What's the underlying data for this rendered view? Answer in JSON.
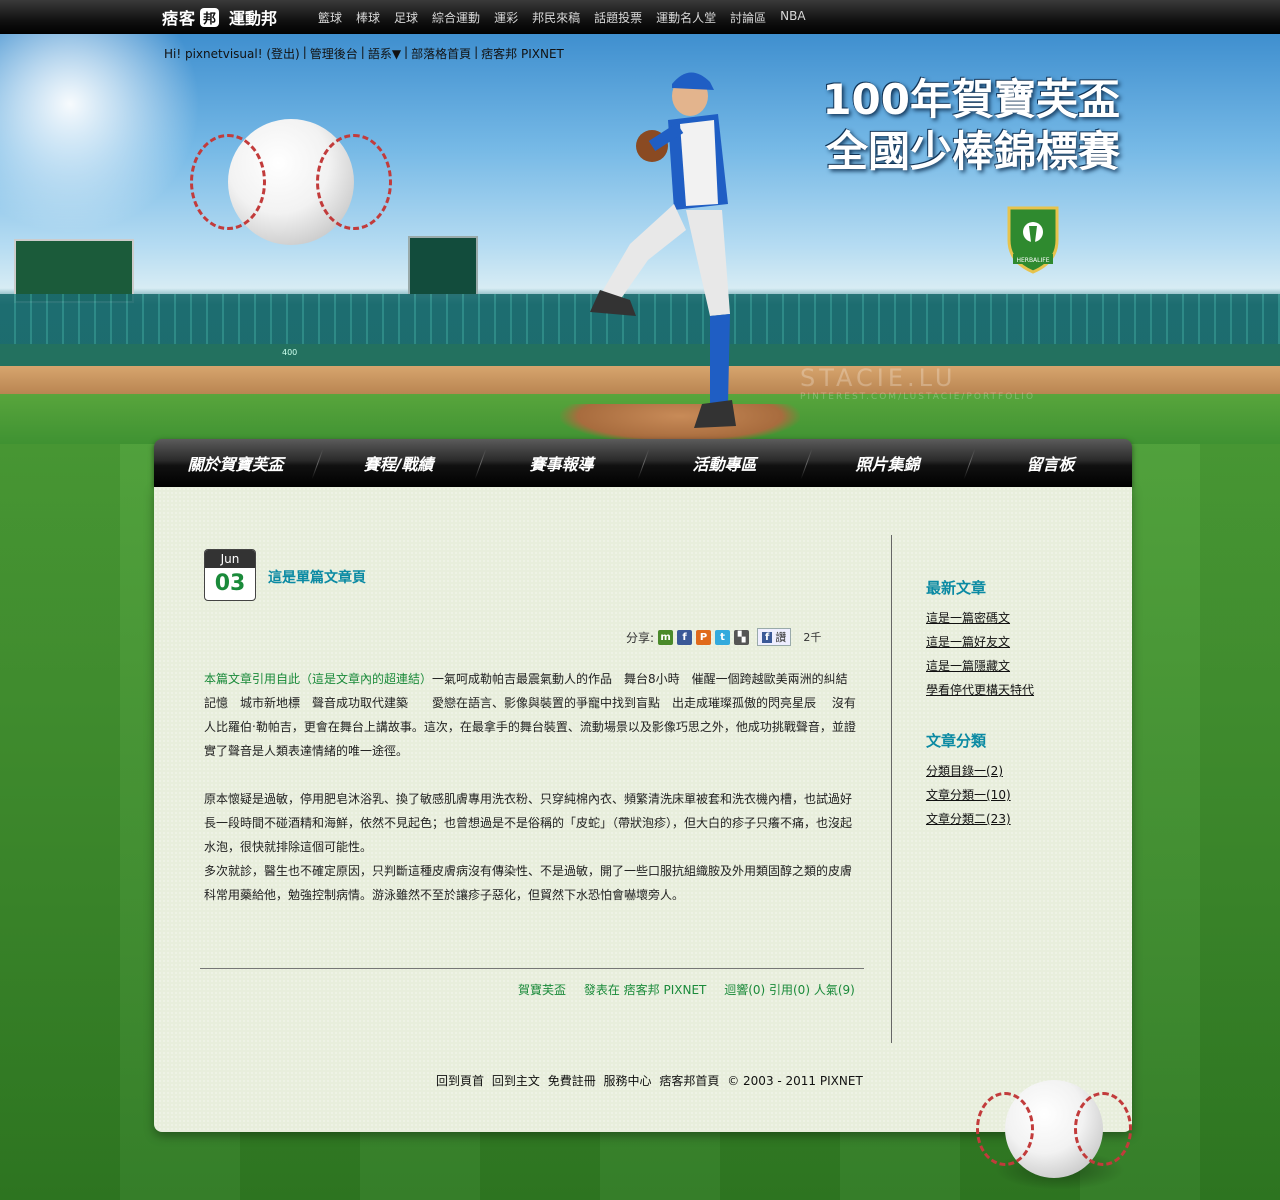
{
  "topbar": {
    "brand_main": "痞客",
    "brand_badge": "邦",
    "brand_sub": "運動邦",
    "nav": [
      "籃球",
      "棒球",
      "足球",
      "綜合運動",
      "運彩",
      "邦民來稿",
      "話題投票",
      "運動名人堂",
      "討論區",
      "NBA"
    ]
  },
  "userbar": {
    "greeting": "Hi! pixnetvisual! (登出)",
    "admin": "管理後台",
    "lang": "語系▼",
    "blog_home": "部落格首頁",
    "pixnet": "痞客邦 PIXNET"
  },
  "hero": {
    "title_line1": "100年賀寶芙盃",
    "title_line2": "全國少棒錦標賽",
    "herbalife": "HERBALIFE",
    "watermark": "STACIE.LU",
    "watermark_sub": "PINTEREST.COM/LUSTACIE/PORTFOLIO",
    "wall_marker": "400"
  },
  "mainnav": [
    "關於賀寶芙盃",
    "賽程/戰績",
    "賽事報導",
    "活動專區",
    "照片集錦",
    "留言板"
  ],
  "post": {
    "month": "Jun",
    "day": "03",
    "title": "這是單篇文章頁",
    "share_label": "分享:",
    "fb_like": "讚",
    "fb_count": "2千",
    "source_link": "本篇文章引用自此（這是文章內的超連結）",
    "p1_rest": "一氣呵成勒帕吉最震氣動人的作品　舞台8小時　催醒一個跨越歐美兩洲的糾結記憶　城市新地標　聲音成功取代建築　　愛戀在語言、影像與裝置的爭寵中找到盲點　出走成璀璨孤傲的閃亮星辰　 沒有人比羅伯‧勒帕吉，更會在舞台上講故事。這次，在最拿手的舞台裝置、流動場景以及影像巧思之外，他成功挑戰聲音，並證實了聲音是人類表達情緒的唯一途徑。",
    "p2": "原本懷疑是過敏，停用肥皂沐浴乳、換了敏感肌膚專用洗衣粉、只穿純棉內衣、頻繁清洗床單被套和洗衣機內槽，也試過好長一段時間不碰酒精和海鮮，依然不見起色；也曾想過是不是俗稱的「皮蛇」（帶狀泡疹），但大白的疹子只癢不痛，也沒起水泡，很快就排除這個可能性。",
    "p3": "多次就診，醫生也不確定原因，只判斷這種皮膚病沒有傳染性、不是過敏，開了一些口服抗組織胺及外用類固醇之類的皮膚科常用藥給他，勉強控制病情。游泳雖然不至於讓疹子惡化，但貿然下水恐怕會嚇壞旁人。",
    "meta_author": "賀寶芙盃",
    "meta_posted": "發表在 痞客邦 PIXNET",
    "meta_stats": "迴響(0) 引用(0) 人氣(9)"
  },
  "sidebar": {
    "latest_title": "最新文章",
    "latest": [
      "這是一篇密碼文",
      "這是一篇好友文",
      "這是一篇隱藏文",
      "學看停代更構天特代"
    ],
    "cat_title": "文章分類",
    "cats": [
      "分類目錄一(2)",
      "文章分類一(10)",
      "文章分類二(23)"
    ]
  },
  "footer": {
    "items": [
      "回到頁首",
      "回到主文",
      "免費註冊",
      "服務中心",
      "痞客邦首頁"
    ],
    "copyright": "© 2003 - 2011 PIXNET"
  }
}
